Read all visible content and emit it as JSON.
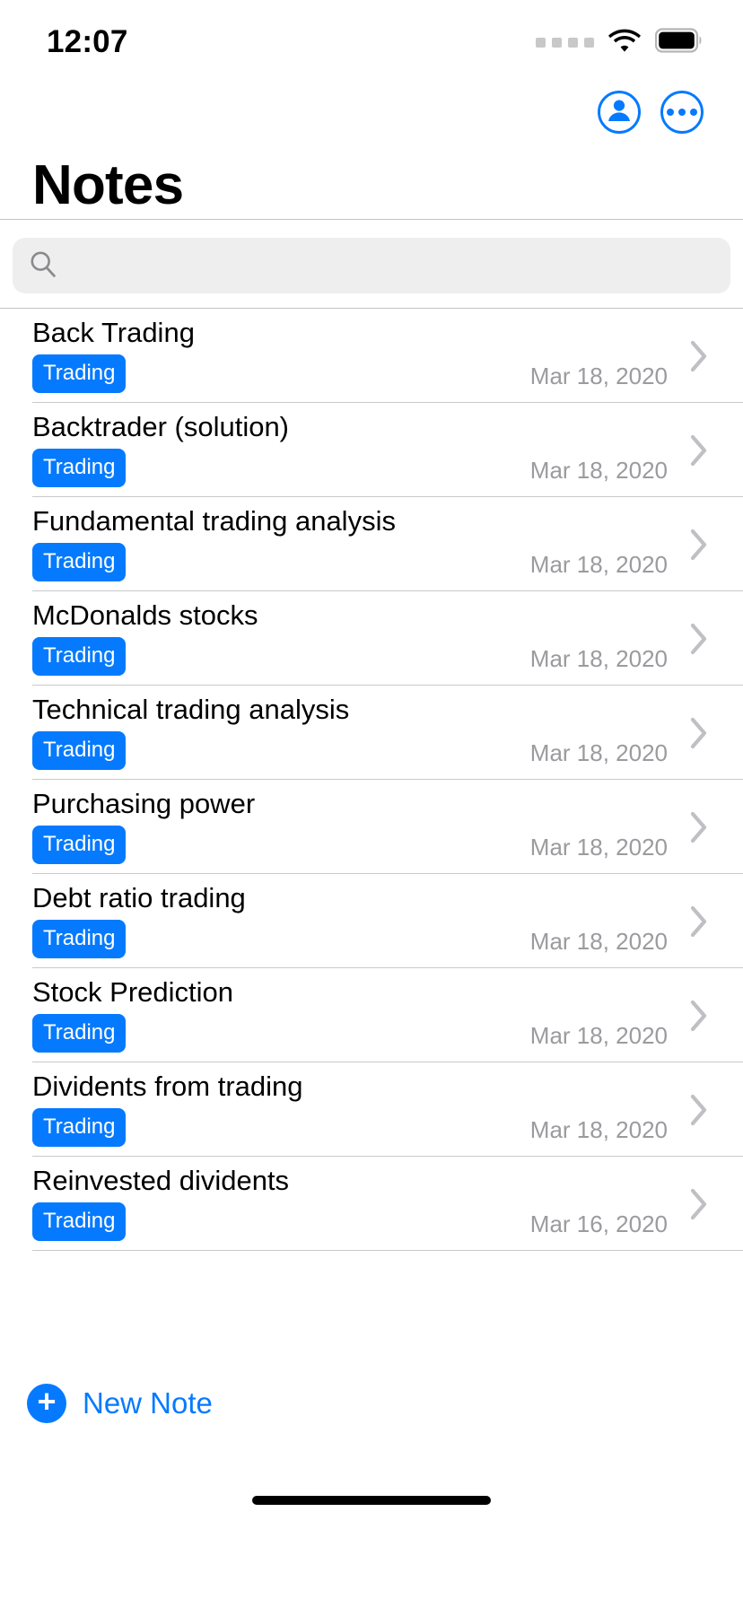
{
  "status_bar": {
    "time": "12:07",
    "signal_icon": "signal-dots-icon",
    "wifi_icon": "wifi-icon",
    "battery_icon": "battery-full-icon",
    "signal_dot_count": 4
  },
  "nav": {
    "account_button_label": "Account",
    "account_icon": "account-circle-icon",
    "more_button_label": "More",
    "more_icon": "ellipsis-circle-icon"
  },
  "header": {
    "title": "Notes"
  },
  "search": {
    "value": "",
    "placeholder": "",
    "icon": "search-icon"
  },
  "colors": {
    "accent": "#057aff",
    "tag_background": "#057aff",
    "tag_text": "#ffffff",
    "date_text": "#9b9b9f",
    "search_background": "#eeeeef",
    "separator": "#c9c9cb",
    "title_text": "#000000"
  },
  "list": {
    "chevron_icon": "chevron-right-icon",
    "notes": [
      {
        "title": "Back Trading",
        "tag": "Trading",
        "date": "Mar 18, 2020"
      },
      {
        "title": "Backtrader (solution)",
        "tag": "Trading",
        "date": "Mar 18, 2020"
      },
      {
        "title": "Fundamental trading analysis",
        "tag": "Trading",
        "date": "Mar 18, 2020"
      },
      {
        "title": "McDonalds stocks",
        "tag": "Trading",
        "date": "Mar 18, 2020"
      },
      {
        "title": "Technical trading analysis",
        "tag": "Trading",
        "date": "Mar 18, 2020"
      },
      {
        "title": "Purchasing power",
        "tag": "Trading",
        "date": "Mar 18, 2020"
      },
      {
        "title": "Debt ratio trading",
        "tag": "Trading",
        "date": "Mar 18, 2020"
      },
      {
        "title": "Stock Prediction",
        "tag": "Trading",
        "date": "Mar 18, 2020"
      },
      {
        "title": "Dividents from trading",
        "tag": "Trading",
        "date": "Mar 18, 2020"
      },
      {
        "title": "Reinvested dividents",
        "tag": "Trading",
        "date": "Mar 16, 2020"
      }
    ]
  },
  "footer": {
    "new_note_label": "New Note",
    "new_note_icon": "plus-circle-icon"
  },
  "home_indicator": {
    "name": "home-indicator"
  }
}
